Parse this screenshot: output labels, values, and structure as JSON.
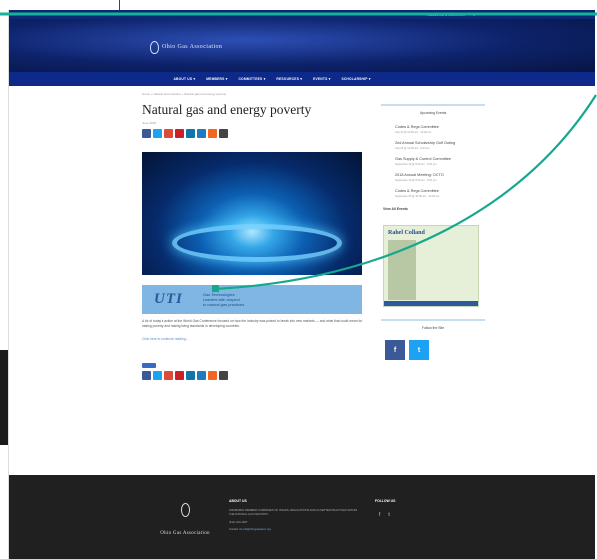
{
  "topbar": {
    "login": "WELCOME & REGISTER",
    "cart": "0"
  },
  "brand": {
    "name": "Ohio Gas Association"
  },
  "nav": {
    "items": [
      "ABOUT US ▾",
      "MEMBERS ▾",
      "COMMITTEES ▾",
      "RESOURCES ▾",
      "EVENTS ▾",
      "SCHOLARSHIP ▾"
    ]
  },
  "article": {
    "breadcrumb": "Home » Natural Gas Industry » Natural gas and energy poverty",
    "title": "Natural gas and energy poverty",
    "date": "June 2018",
    "ad": {
      "brand": "UTI",
      "line1": "Gas Technologies",
      "line2": "Leaders with respect",
      "line3": "to natural gas practices"
    },
    "body": "A lot of today's action at the World Gas Conference focused on how the industry was poised to break into new markets — and what that could mean for raising poverty and raising living standards in developing countries.",
    "link": "Click here to continue reading..."
  },
  "share_colors": [
    "#3b5998",
    "#1da1f2",
    "#dd4b39",
    "#cb2027",
    "#0e76a8",
    "#1f7bc1",
    "#f26522",
    "#444444"
  ],
  "sidebar": {
    "events_heading": "Upcoming Events",
    "events": [
      {
        "title": "Codes & Regs Committee",
        "date": "July 10 @ 10:00 am - 12:00 pm"
      },
      {
        "title": "2nd Annual Scholarship Golf Outing",
        "date": "July 26 @ 10:00 am - 6:00 pm"
      },
      {
        "title": "Gas Supply & Control Committee",
        "date": "September 12 @ 9:00 am - 3:00 pm"
      },
      {
        "title": "2018 Annual Meeting: OCTO",
        "date": "September 19 @ 8:00 am - 5:00 pm"
      },
      {
        "title": "Codes & Regs Committee",
        "date": "September 25 @ 10:00 am - 12:00 pm"
      }
    ],
    "view_all": "View All Events",
    "ad_name": "Rahel Colland",
    "follow_heading": "Follow the Site",
    "social": [
      "f",
      "t"
    ]
  },
  "footer": {
    "brand": "Ohio Gas Association",
    "about_heading": "ABOUT US",
    "about_text": "INFORMING MEMBER COMPANIES OF ISSUES, REGULATIONS AND ACCEPTED PRACTICES WITHIN THE NATURAL GAS INDUSTRY.",
    "phone": "(614) 224-1487",
    "contact": "Contact us",
    "email": "info@ohiogasassoc.org",
    "follow_heading": "FOLLOW US",
    "social": [
      "f",
      "t"
    ]
  }
}
